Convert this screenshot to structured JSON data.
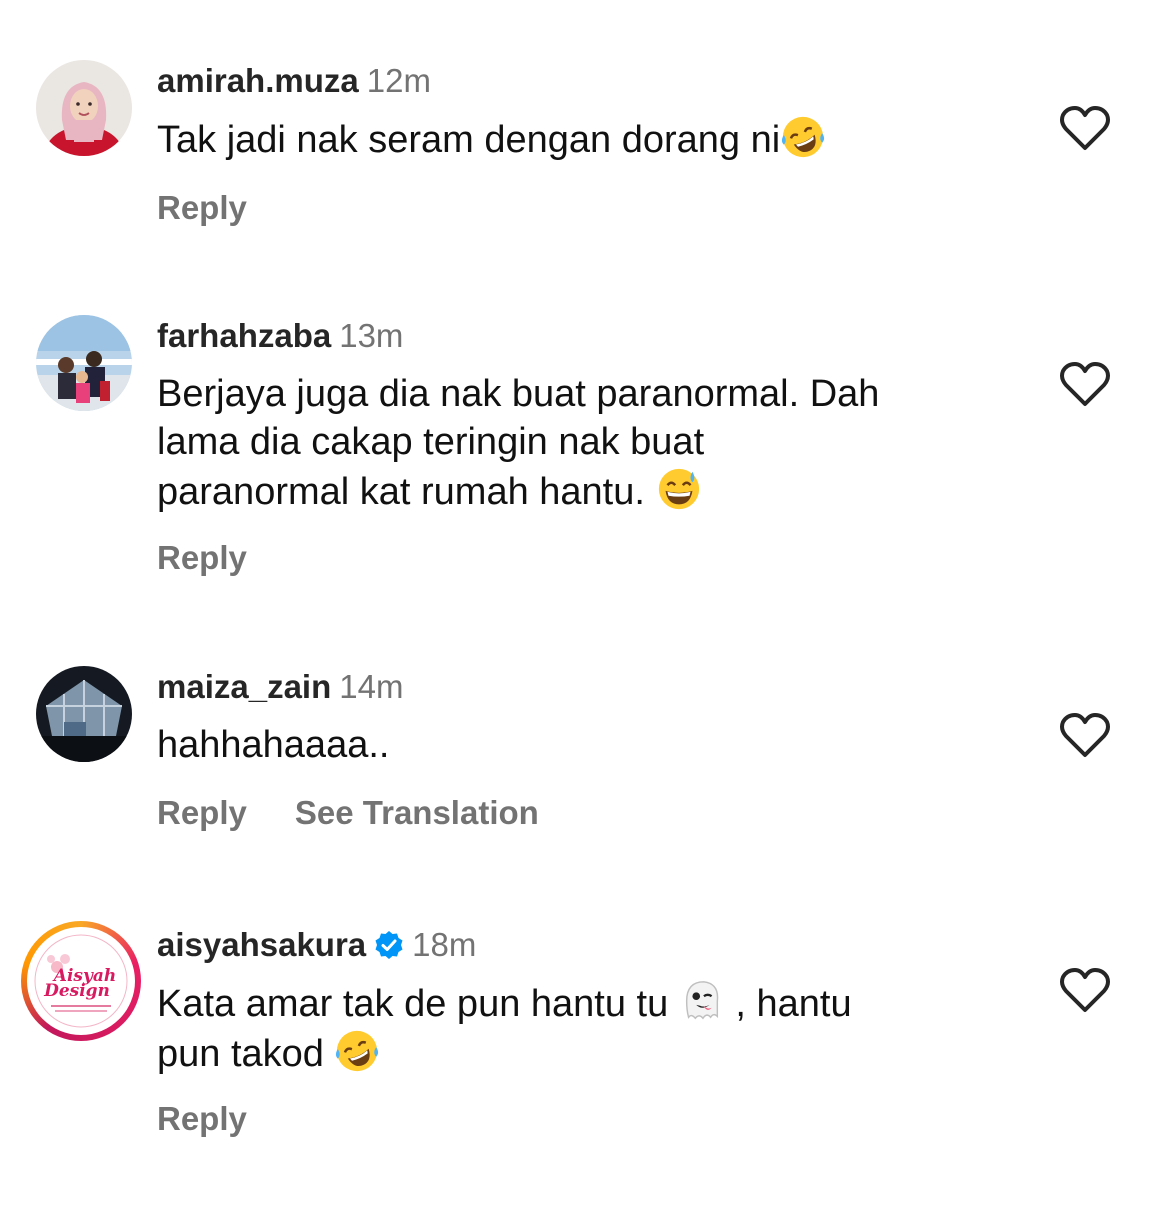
{
  "comments": [
    {
      "username": "amirah.muza",
      "time": "12m",
      "text": "Tak jadi nak seram dengan dorang ni",
      "reply_label": "Reply",
      "verified": false,
      "avatar_icon": "profile-photo-woman-hijab"
    },
    {
      "username": "farhahzaba",
      "time": "13m",
      "text_lines": [
        "Berjaya juga dia nak buat paranormal. Dah",
        "lama dia cakap teringin nak buat",
        "paranormal kat rumah hantu."
      ],
      "reply_label": "Reply",
      "verified": false,
      "avatar_icon": "profile-photo-family"
    },
    {
      "username": "maiza_zain",
      "time": "14m",
      "text": "hahhahaaaa..",
      "reply_label": "Reply",
      "translate_label": "See Translation",
      "verified": false,
      "avatar_icon": "profile-photo-skylight"
    },
    {
      "username": "aisyahsakura",
      "time": "18m",
      "text_line1_a": "Kata amar tak de pun hantu tu",
      "text_line1_b": ", hantu",
      "text_line2": "pun takod",
      "reply_label": "Reply",
      "verified": true,
      "avatar_icon": "profile-logo-aisyah-design",
      "avatar_logo_text": [
        "Aisyah",
        "Design"
      ]
    }
  ],
  "colors": {
    "username": "#262626",
    "muted": "#737373",
    "verified": "#0095f6",
    "story_ring": [
      "#f9a825",
      "#e91e63"
    ]
  }
}
